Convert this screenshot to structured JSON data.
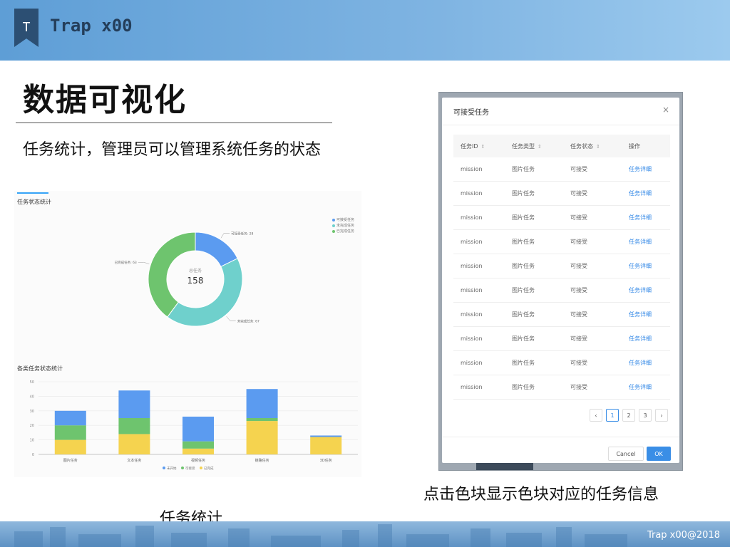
{
  "header": {
    "logo_letter": "T",
    "brand": "Trap x00"
  },
  "slide": {
    "title": "数据可视化",
    "subtitle": "任务统计，管理员可以管理系统任务的状态",
    "caption_left": "任务统计",
    "caption_right": "点击色块显示色块对应的任务信息",
    "footer": "Trap x00@2018"
  },
  "colors": {
    "blue": "#5b9bf0",
    "teal": "#6fd0cc",
    "green": "#6ec46e",
    "yellow": "#f5d34f",
    "accent": "#3a8ee6"
  },
  "panel": {
    "pie_title": "任务状态统计",
    "bar_title": "各类任务状态统计",
    "pie_center_label": "总任务",
    "pie_center_value": "158"
  },
  "chart_data": [
    {
      "type": "pie",
      "title": "任务状态统计",
      "total": 158,
      "slices": [
        {
          "name": "可接受任务",
          "value": 28,
          "label": "可接受任务: 28",
          "color": "#5b9bf0"
        },
        {
          "name": "未完成任务",
          "value": 67,
          "label": "未完成任务: 67",
          "color": "#6fd0cc"
        },
        {
          "name": "已完成任务",
          "value": 63,
          "label": "已完成任务: 63",
          "color": "#6ec46e"
        }
      ],
      "legend": [
        "可接受任务",
        "未完成任务",
        "已完成任务"
      ],
      "legend_position": "top-right"
    },
    {
      "type": "bar",
      "title": "各类任务状态统计",
      "stacked": true,
      "categories": [
        "图片任务",
        "文本任务",
        "视频任务",
        "链路任务",
        "3D任务"
      ],
      "series": [
        {
          "name": "已完成",
          "values": [
            10,
            14,
            4,
            23,
            12
          ],
          "color": "#f5d34f"
        },
        {
          "name": "可接受",
          "values": [
            10,
            11,
            5,
            2,
            0
          ],
          "color": "#6ec46e"
        },
        {
          "name": "未开始",
          "values": [
            10,
            19,
            17,
            20,
            1
          ],
          "color": "#5b9bf0"
        }
      ],
      "legend": [
        "未开始",
        "可接受",
        "已完成"
      ],
      "legend_position": "bottom",
      "yticks": [
        0,
        10,
        20,
        30,
        40,
        50
      ],
      "ylim": [
        0,
        50
      ],
      "grid": true
    }
  ],
  "dialog": {
    "title": "可接受任务",
    "close": "×",
    "columns": [
      "任务ID",
      "任务类型",
      "任务状态",
      "操作"
    ],
    "rows": [
      [
        "mission",
        "图片任务",
        "可接受",
        "任务详细"
      ],
      [
        "mission",
        "图片任务",
        "可接受",
        "任务详细"
      ],
      [
        "mission",
        "图片任务",
        "可接受",
        "任务详细"
      ],
      [
        "mission",
        "图片任务",
        "可接受",
        "任务详细"
      ],
      [
        "mission",
        "图片任务",
        "可接受",
        "任务详细"
      ],
      [
        "mission",
        "图片任务",
        "可接受",
        "任务详细"
      ],
      [
        "mission",
        "图片任务",
        "可接受",
        "任务详细"
      ],
      [
        "mission",
        "图片任务",
        "可接受",
        "任务详细"
      ],
      [
        "mission",
        "图片任务",
        "可接受",
        "任务详细"
      ],
      [
        "mission",
        "图片任务",
        "可接受",
        "任务详细"
      ]
    ],
    "pagination": {
      "prev": "‹",
      "pages": [
        "1",
        "2",
        "3"
      ],
      "current": "1",
      "next": "›"
    },
    "cancel_label": "Cancel",
    "ok_label": "OK"
  }
}
